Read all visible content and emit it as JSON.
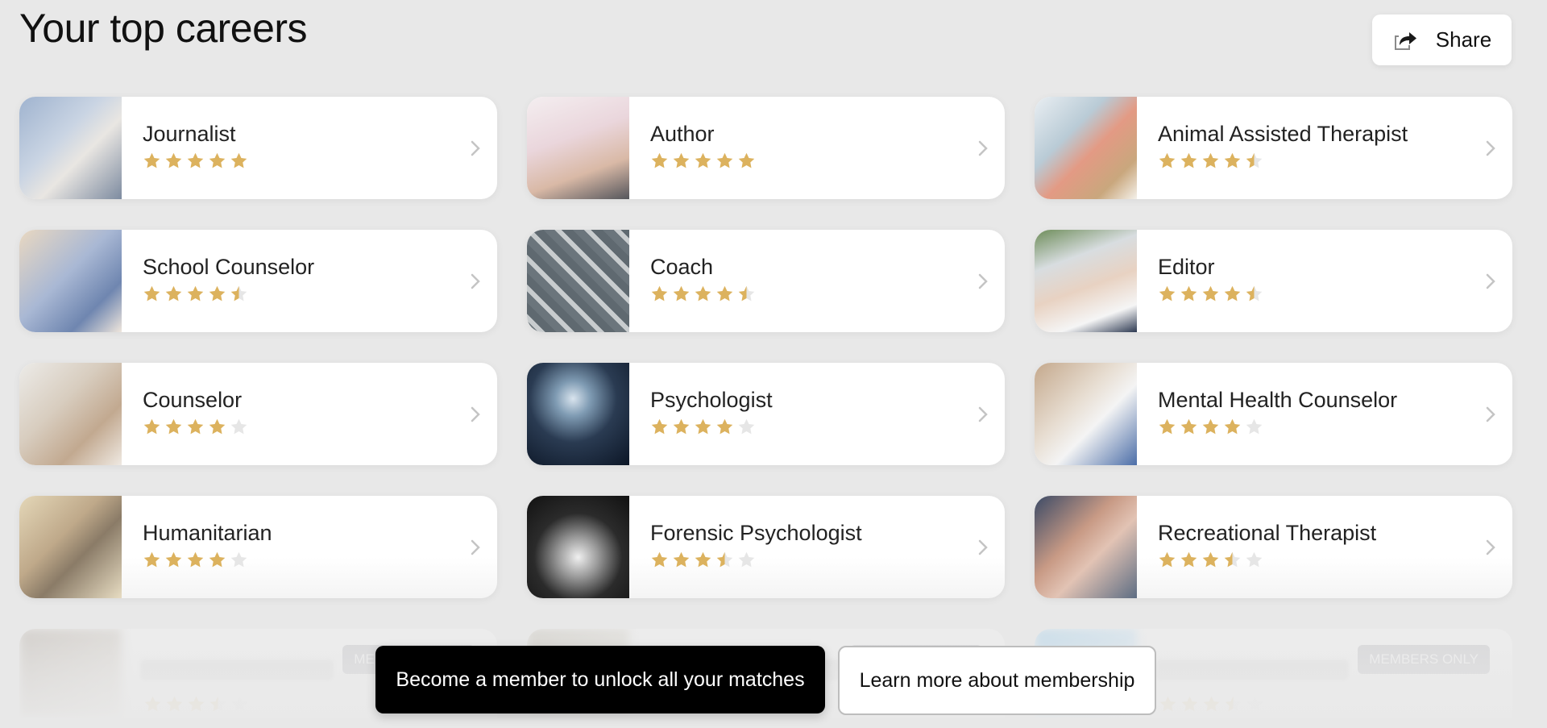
{
  "header": {
    "title": "Your top careers",
    "share_label": "Share",
    "share_icon": "share-icon"
  },
  "colors": {
    "star_filled": "#dcb25e",
    "star_empty": "#e6e6e6",
    "background": "#e8e8e8",
    "primary_cta_bg": "#000000"
  },
  "careers": [
    {
      "name": "Journalist",
      "rating": 5,
      "image": "reporter-with-microphones"
    },
    {
      "name": "Author",
      "rating": 5,
      "image": "hands-typing-on-laptop"
    },
    {
      "name": "Animal Assisted Therapist",
      "rating": 4.5,
      "image": "therapy-dog-at-bedside"
    },
    {
      "name": "School Counselor",
      "rating": 4.5,
      "image": "counselor-with-students"
    },
    {
      "name": "Coach",
      "rating": 4.5,
      "image": "arrows-around-feet"
    },
    {
      "name": "Editor",
      "rating": 4.5,
      "image": "hand-marking-document"
    },
    {
      "name": "Counselor",
      "rating": 4,
      "image": "person-taking-notes"
    },
    {
      "name": "Psychologist",
      "rating": 4,
      "image": "glowing-brain-head"
    },
    {
      "name": "Mental Health Counselor",
      "rating": 4,
      "image": "therapy-session-notes"
    },
    {
      "name": "Humanitarian",
      "rating": 4,
      "image": "joined-hands"
    },
    {
      "name": "Forensic Psychologist",
      "rating": 3.5,
      "image": "puzzle-head"
    },
    {
      "name": "Recreational Therapist",
      "rating": 3.5,
      "image": "stacked-hands-seniors"
    }
  ],
  "locked": {
    "badge_label": "MEMBERS ONLY",
    "items": [
      {
        "rating": 3.5
      },
      {
        "rating": 3.5
      },
      {
        "rating": 3.5
      }
    ]
  },
  "cta": {
    "primary_label": "Become a member to unlock all your matches",
    "secondary_label": "Learn more about membership"
  }
}
